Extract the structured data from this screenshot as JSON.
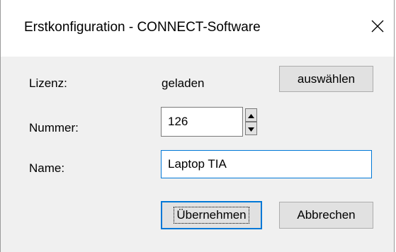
{
  "window": {
    "title": "Erstkonfiguration - CONNECT-Software",
    "close_icon": "close-icon"
  },
  "license": {
    "label": "Lizenz:",
    "status": "geladen",
    "select_button": "auswählen"
  },
  "number": {
    "label": "Nummer:",
    "value": "126",
    "up_icon": "spin-up-icon",
    "down_icon": "spin-down-icon"
  },
  "name": {
    "label": "Name:",
    "value": "Laptop TIA"
  },
  "actions": {
    "apply_label": "Übernehmen",
    "cancel_label": "Abbrechen"
  },
  "colors": {
    "focus_accent": "#0078d7",
    "dialog_background": "#f0f0f0",
    "button_face": "#e1e1e1"
  }
}
